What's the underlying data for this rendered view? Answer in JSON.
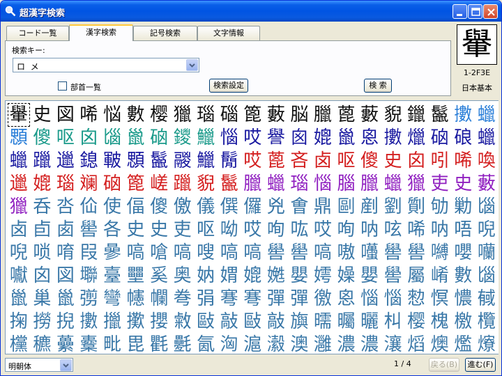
{
  "window": {
    "title": "超漢字検索"
  },
  "tabs": [
    {
      "label": "コード一覧"
    },
    {
      "label": "漢字検索"
    },
    {
      "label": "記号検索"
    },
    {
      "label": "文字情報"
    }
  ],
  "search": {
    "key_label": "検索キー:",
    "key_value": "ロ  メ",
    "radical_label": "部首一覧",
    "settings_button": "検索設定",
    "search_button": "検 索"
  },
  "preview": {
    "char": "轝",
    "code": "1-2F3E",
    "charset": "日本基本"
  },
  "colors": {
    "black": "#111111",
    "light_blue": "#2b7fd8",
    "teal": "#1a9a8a",
    "navy": "#1a1aa0",
    "red": "#d42020",
    "purple": "#9020c0",
    "steel": "#3a78a8"
  },
  "grid": {
    "rows": [
      {
        "chars": [
          "轝",
          "史",
          "図",
          "唏",
          "悩",
          "數",
          "樱",
          "獵",
          "瑙",
          "碯",
          "篦",
          "藪",
          "脳",
          "臘",
          "蓖",
          "藪",
          "貎",
          "鑞",
          "鬣",
          "擻",
          "蠟"
        ],
        "colors": [
          "black",
          "black",
          "black",
          "black",
          "black",
          "black",
          "black",
          "black",
          "black",
          "black",
          "black",
          "black",
          "black",
          "black",
          "black",
          "black",
          "black",
          "black",
          "black",
          "light_blue",
          "light_blue"
        ]
      },
      {
        "chars": [
          "顋",
          "傻",
          "呕",
          "囟",
          "匘",
          "巤",
          "硇",
          "鑁",
          "鱲",
          "惱",
          "哎",
          "譽",
          "囪",
          "媲",
          "巤",
          "恖",
          "擻",
          "爉",
          "硇",
          "硠",
          "蠟"
        ],
        "colors": [
          "light_blue",
          "teal",
          "teal",
          "teal",
          "teal",
          "teal",
          "teal",
          "teal",
          "teal",
          "navy",
          "navy",
          "navy",
          "navy",
          "navy",
          "navy",
          "navy",
          "navy",
          "navy",
          "navy",
          "navy",
          "navy"
        ]
      },
      {
        "chars": [
          "蠟",
          "躐",
          "邋",
          "鎴",
          "皸",
          "顋",
          "鬣",
          "鬷",
          "鱲",
          "鬜",
          "哎",
          "蓖",
          "吝",
          "卤",
          "呕",
          "傻",
          "史",
          "囟",
          "吲",
          "唏",
          "喚"
        ],
        "colors": [
          "navy",
          "navy",
          "navy",
          "navy",
          "navy",
          "navy",
          "navy",
          "navy",
          "navy",
          "navy",
          "red",
          "red",
          "red",
          "red",
          "red",
          "red",
          "red",
          "red",
          "red",
          "red",
          "red"
        ]
      },
      {
        "chars": [
          "邋",
          "媲",
          "瑙",
          "斓",
          "硇",
          "篦",
          "嵯",
          "躐",
          "貎",
          "鬣",
          "臘",
          "蠟",
          "瑙",
          "惱",
          "腦",
          "臘",
          "蠟",
          "獵",
          "吏",
          "史",
          "藪"
        ],
        "colors": [
          "red",
          "red",
          "red",
          "red",
          "red",
          "red",
          "red",
          "red",
          "red",
          "red",
          "purple",
          "purple",
          "purple",
          "purple",
          "purple",
          "purple",
          "purple",
          "purple",
          "purple",
          "purple",
          "purple"
        ]
      },
      {
        "chars": [
          "獵",
          "呑",
          "呇",
          "佡",
          "使",
          "偪",
          "傻",
          "儌",
          "儀",
          "僎",
          "儸",
          "兇",
          "㑹",
          "鼎",
          "剾",
          "剷",
          "劉",
          "劕",
          "劬",
          "勦",
          "匘"
        ],
        "colors": [
          "purple",
          "steel",
          "steel",
          "steel",
          "steel",
          "steel",
          "steel",
          "steel",
          "steel",
          "steel",
          "steel",
          "steel",
          "steel",
          "steel",
          "steel",
          "steel",
          "steel",
          "steel",
          "steel",
          "steel",
          "steel"
        ]
      },
      {
        "chars": [
          "卤",
          "卣",
          "卥",
          "嚳",
          "各",
          "史",
          "史",
          "吏",
          "呕",
          "呦",
          "哎",
          "咰",
          "吰",
          "哎",
          "咰",
          "呐",
          "呟",
          "唏",
          "呐",
          "唔",
          "唲"
        ],
        "colors": [
          "steel",
          "steel",
          "steel",
          "steel",
          "steel",
          "steel",
          "steel",
          "steel",
          "steel",
          "steel",
          "steel",
          "steel",
          "steel",
          "steel",
          "steel",
          "steel",
          "steel",
          "steel",
          "steel",
          "steel",
          "steel"
        ]
      },
      {
        "chars": [
          "唲",
          "唢",
          "唷",
          "叚",
          "曑",
          "嗃",
          "嗆",
          "嗃",
          "嗖",
          "嗃",
          "嗃",
          "嚳",
          "嚳",
          "嗃",
          "嗷",
          "囆",
          "嚳",
          "嚳",
          "嚩",
          "嚶",
          "囒"
        ],
        "colors": [
          "steel",
          "steel",
          "steel",
          "steel",
          "steel",
          "steel",
          "steel",
          "steel",
          "steel",
          "steel",
          "steel",
          "steel",
          "steel",
          "steel",
          "steel",
          "steel",
          "steel",
          "steel",
          "steel",
          "steel",
          "steel"
        ]
      },
      {
        "chars": [
          "囐",
          "囟",
          "図",
          "壣",
          "臺",
          "壨",
          "奚",
          "奥",
          "妠",
          "媦",
          "媲",
          "嬎",
          "嬰",
          "嫮",
          "嬠",
          "嬰",
          "嚳",
          "屬",
          "崤",
          "數",
          "匘"
        ],
        "colors": [
          "steel",
          "steel",
          "steel",
          "steel",
          "steel",
          "steel",
          "steel",
          "steel",
          "steel",
          "steel",
          "steel",
          "steel",
          "steel",
          "steel",
          "steel",
          "steel",
          "steel",
          "steel",
          "steel",
          "steel",
          "steel"
        ]
      },
      {
        "chars": [
          "巤",
          "巢",
          "巤",
          "彅",
          "彎",
          "幰",
          "幱",
          "弮",
          "弲",
          "弿",
          "弿",
          "彈",
          "彈",
          "徼",
          "恖",
          "惱",
          "惱",
          "愸",
          "慏",
          "憹",
          "戫"
        ],
        "colors": [
          "steel",
          "steel",
          "steel",
          "steel",
          "steel",
          "steel",
          "steel",
          "steel",
          "steel",
          "steel",
          "steel",
          "steel",
          "steel",
          "steel",
          "steel",
          "steel",
          "steel",
          "steel",
          "steel",
          "steel",
          "steel"
        ]
      },
      {
        "chars": [
          "掬",
          "撈",
          "掜",
          "擻",
          "擸",
          "擹",
          "攖",
          "敹",
          "敺",
          "敲",
          "敺",
          "敲",
          "旟",
          "曘",
          "曯",
          "曬",
          "朻",
          "樱",
          "槐",
          "檄",
          "欖"
        ],
        "colors": [
          "steel",
          "steel",
          "steel",
          "steel",
          "steel",
          "steel",
          "steel",
          "steel",
          "steel",
          "steel",
          "steel",
          "steel",
          "steel",
          "steel",
          "steel",
          "steel",
          "steel",
          "steel",
          "steel",
          "steel",
          "steel"
        ]
      },
      {
        "chars": [
          "欓",
          "穮",
          "虆",
          "櫜",
          "毗",
          "毘",
          "氍",
          "氎",
          "氤",
          "洶",
          "滬",
          "瀫",
          "澳",
          "灉",
          "濃",
          "濃",
          "瀼",
          "熖",
          "燠",
          "爁",
          "爎"
        ],
        "colors": [
          "steel",
          "steel",
          "steel",
          "steel",
          "steel",
          "steel",
          "steel",
          "steel",
          "steel",
          "steel",
          "steel",
          "steel",
          "steel",
          "steel",
          "steel",
          "steel",
          "steel",
          "steel",
          "steel",
          "steel",
          "steel"
        ]
      }
    ]
  },
  "footer": {
    "font_value": "明朝体",
    "page_indicator": "1 / 4",
    "back_button": "戻る(B)",
    "next_button": "進む(F)"
  }
}
